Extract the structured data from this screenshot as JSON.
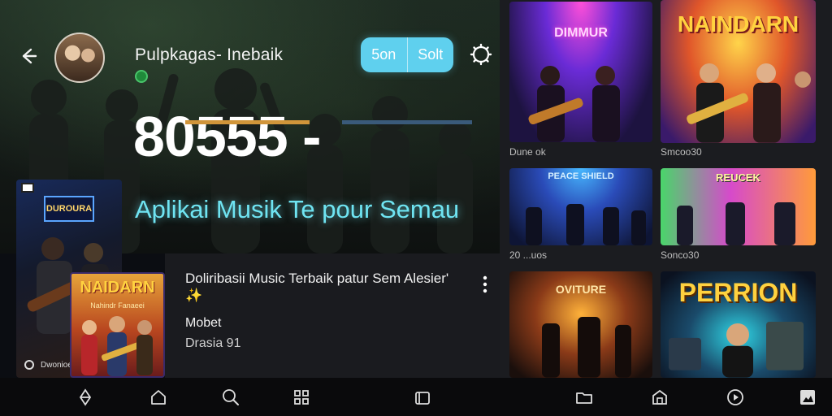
{
  "header": {
    "channel_title": "Pulpkagas- Inebaik",
    "toggle": {
      "left": "5on",
      "right": "Solt"
    }
  },
  "hero": {
    "big_number": "80555 -",
    "tagline": "Aplikai  Musik Te pour Semau"
  },
  "left_card": {
    "logo": "DUROURA",
    "sub": "Dwonioe"
  },
  "album_card": {
    "title": "NAIDARN",
    "sub": "Nahindr Fanaeei"
  },
  "panel": {
    "title": "Doliribasii Music Terbaik patur Sem Alesier'",
    "title_emoji": "✨",
    "artist": "Mobet",
    "meta": "Drasia    91"
  },
  "grid": [
    {
      "title": "DIMMUR",
      "caption": "Dune  ok"
    },
    {
      "title": "NAINDARN",
      "caption": "Smcoo30"
    },
    {
      "title": "PEACE SHIELD",
      "caption": "20 ...uos"
    },
    {
      "title": "REUCEK",
      "caption": "Sonco30"
    },
    {
      "title": "OVITURE",
      "caption": ""
    },
    {
      "title": "PERRION",
      "caption": ""
    }
  ],
  "colors": {
    "accent": "#5fd0ee",
    "tagline": "#6fe4f2",
    "background": "#0b0d12"
  },
  "nav_icons": [
    "explore-icon",
    "home-icon",
    "search-icon",
    "grid-icon",
    "library-icon",
    "folder-icon",
    "store-icon",
    "play-icon",
    "profile-icon"
  ]
}
